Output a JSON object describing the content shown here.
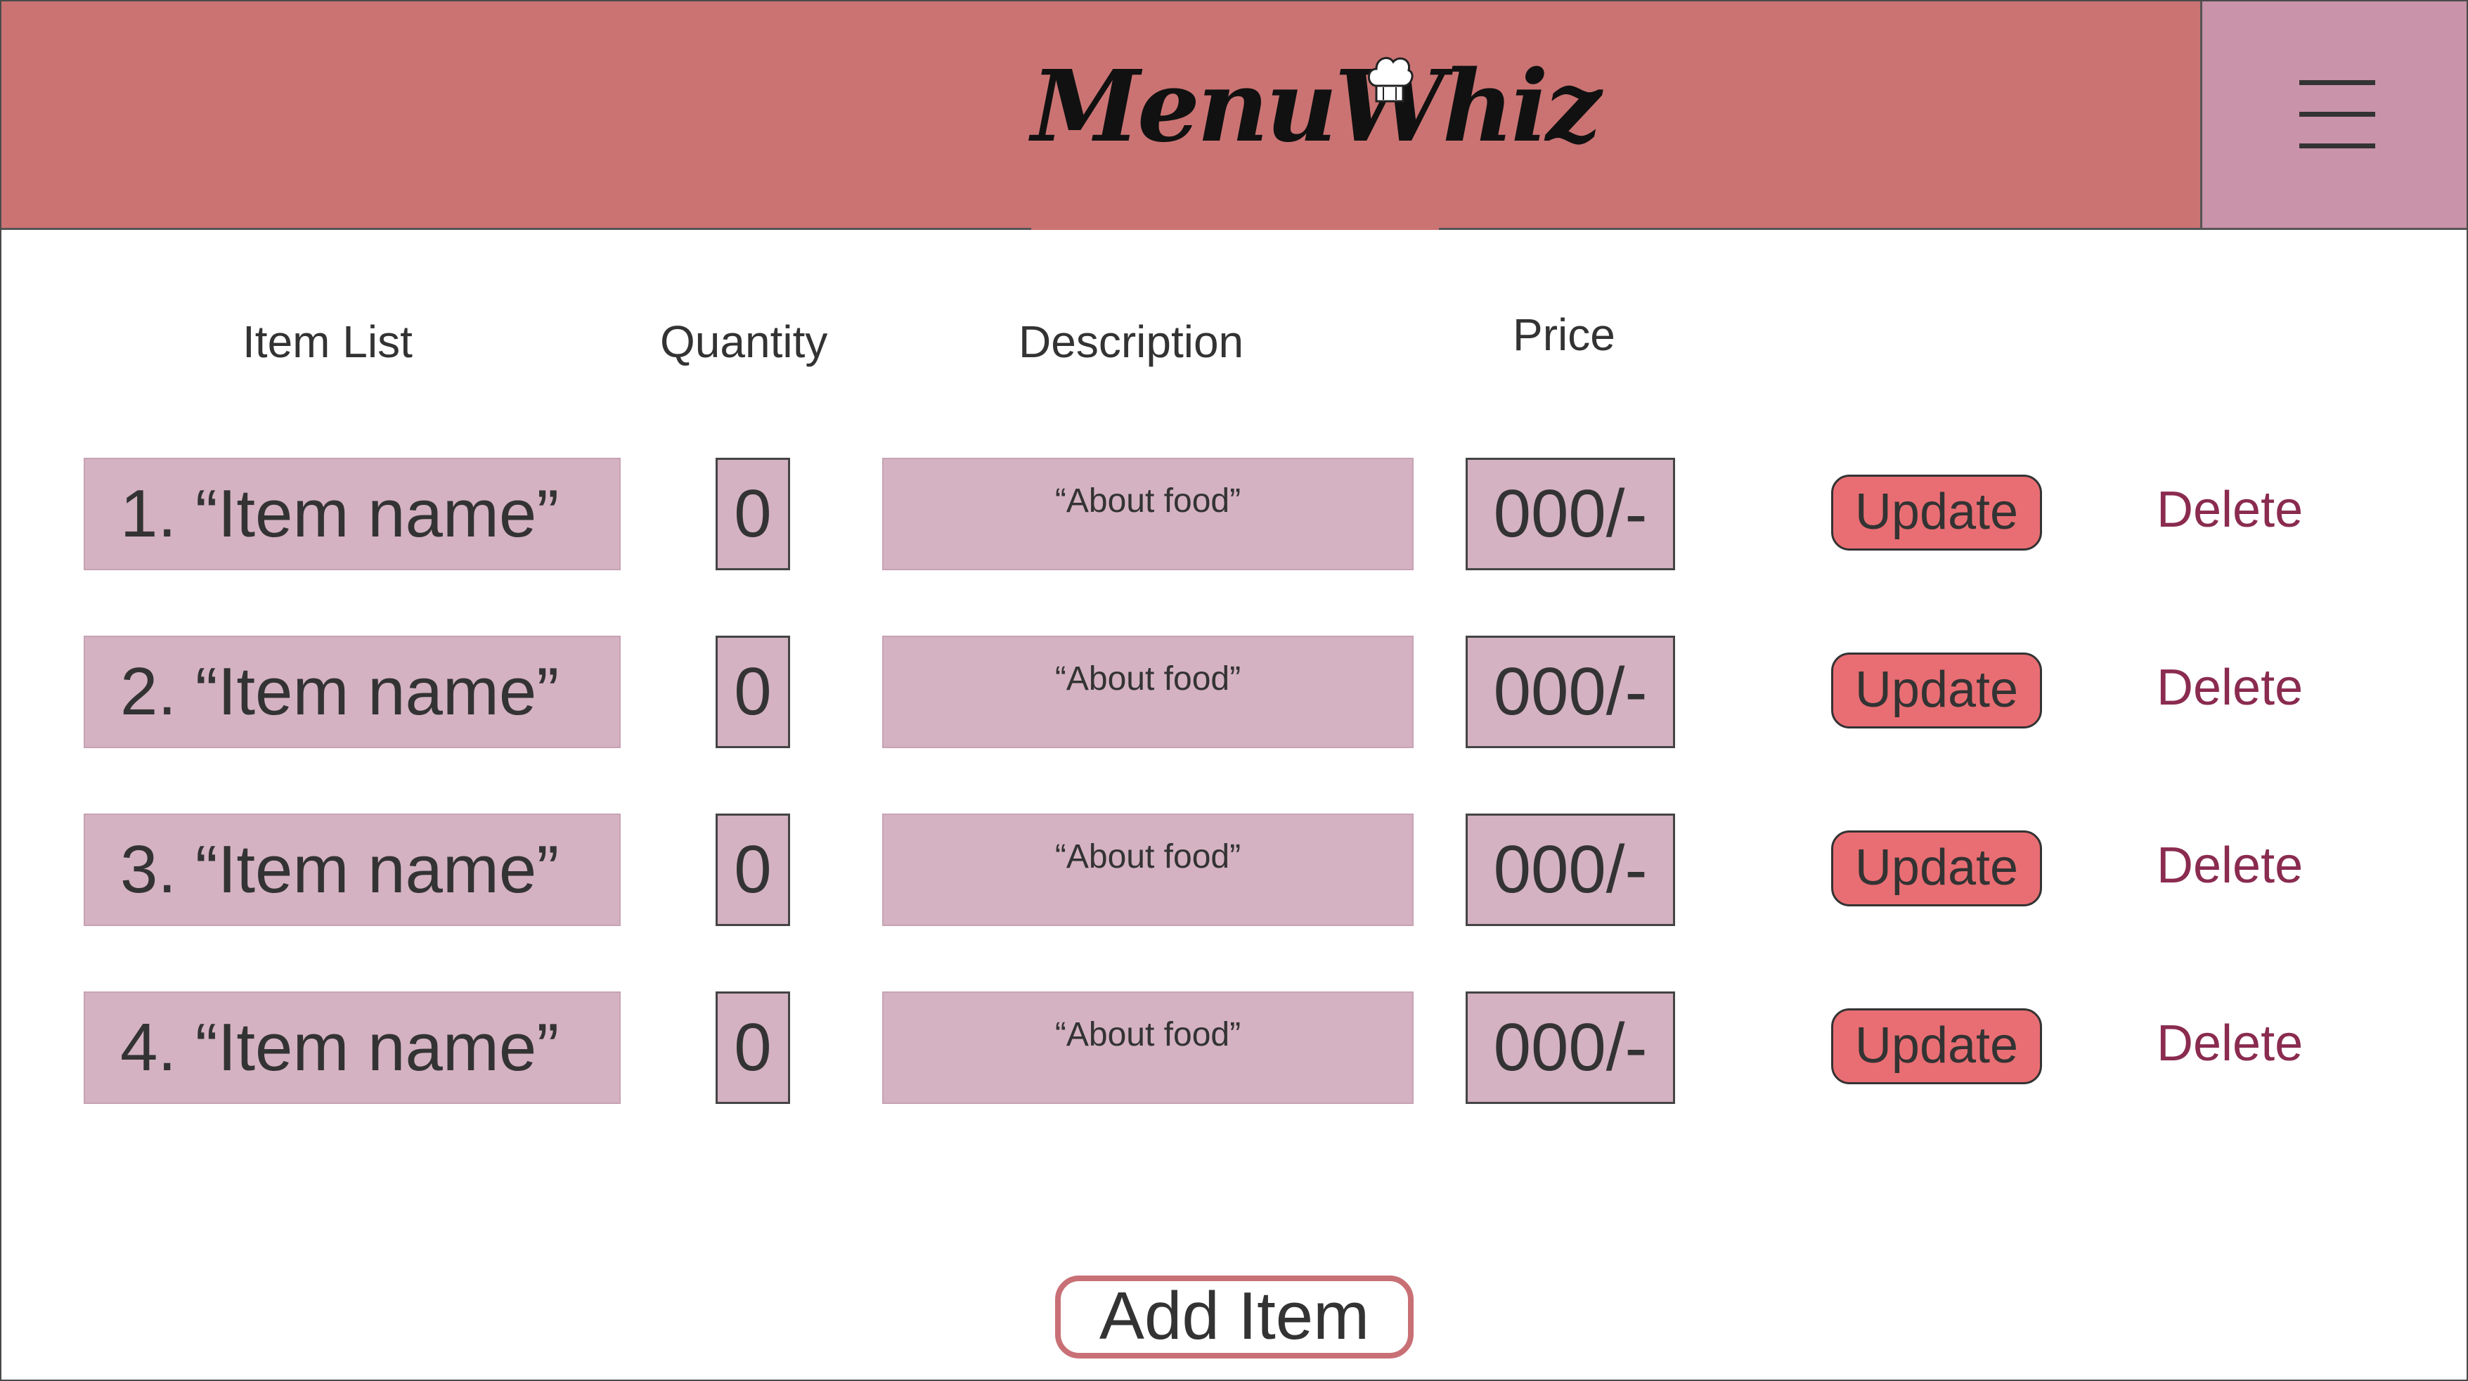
{
  "app": {
    "logo_text": "MenuWhiz",
    "menu_icon": "hamburger-icon",
    "logo_icon": "chef-hat-icon"
  },
  "colors": {
    "header_bg": "#cb7373",
    "menu_panel_bg": "#c993a9",
    "field_bg": "#d4b2c1",
    "update_button_bg": "#e96e73",
    "delete_text": "#8a2b4f",
    "add_button_border": "#c87075"
  },
  "table": {
    "headers": {
      "item_list": "Item List",
      "quantity": "Quantity",
      "description": "Description",
      "price": "Price"
    },
    "rows": [
      {
        "name": "1. “Item name”",
        "quantity": "0",
        "description": "“About food”",
        "price": "000/-",
        "update_label": "Update",
        "delete_label": "Delete"
      },
      {
        "name": "2. “Item name”",
        "quantity": "0",
        "description": "“About food”",
        "price": "000/-",
        "update_label": "Update",
        "delete_label": "Delete"
      },
      {
        "name": "3. “Item name”",
        "quantity": "0",
        "description": "“About food”",
        "price": "000/-",
        "update_label": "Update",
        "delete_label": "Delete"
      },
      {
        "name": "4. “Item name”",
        "quantity": "0",
        "description": "“About food”",
        "price": "000/-",
        "update_label": "Update",
        "delete_label": "Delete"
      }
    ]
  },
  "actions": {
    "add_item_label": "Add Item"
  }
}
